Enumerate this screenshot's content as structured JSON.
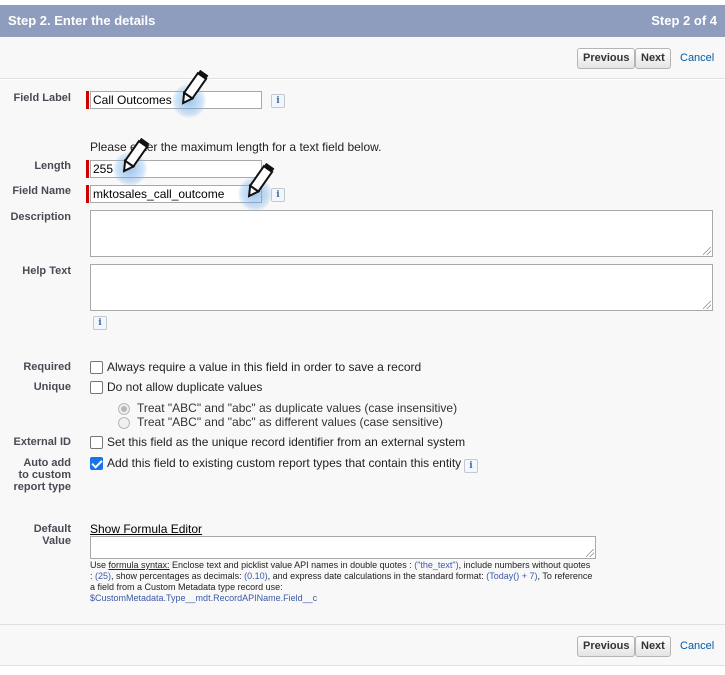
{
  "header": {
    "title": "Step 2. Enter the details",
    "step": "Step 2 of 4"
  },
  "toolbar": {
    "previous": "Previous",
    "next": "Next",
    "cancel": "Cancel"
  },
  "form": {
    "field_label": {
      "label": "Field Label",
      "value": "Call Outcomes"
    },
    "length_hint": "Please enter the maximum length for a text field below.",
    "length": {
      "label": "Length",
      "value": "255"
    },
    "field_name": {
      "label": "Field Name",
      "value": "mktosales_call_outcome"
    },
    "description": {
      "label": "Description",
      "value": ""
    },
    "help_text": {
      "label": "Help Text",
      "value": ""
    },
    "required": {
      "label": "Required",
      "text": "Always require a value in this field in order to save a record",
      "checked": false
    },
    "unique": {
      "label": "Unique",
      "text": "Do not allow duplicate values",
      "checked": false,
      "option_insensitive": "Treat \"ABC\" and \"abc\" as duplicate values (case insensitive)",
      "option_sensitive": "Treat \"ABC\" and \"abc\" as different values (case sensitive)"
    },
    "external_id": {
      "label": "External ID",
      "text": "Set this field as the unique record identifier from an external system",
      "checked": false
    },
    "auto_add": {
      "label_1": "Auto add",
      "label_2": "to custom",
      "label_3": "report type",
      "text": "Add this field to existing custom report types that contain this entity",
      "checked": true
    },
    "default_value": {
      "label_1": "Default",
      "label_2": "Value",
      "link": "Show Formula Editor",
      "value": ""
    },
    "help": {
      "use": "Use ",
      "syntax": "formula syntax:",
      "p1": " Enclose text and picklist value API names in double quotes : ",
      "ex1": "(\"the_text\")",
      "p2": ", include numbers without quotes : ",
      "ex2": "(25)",
      "p3": ", show percentages as decimals: ",
      "ex3": "(0.10)",
      "p4": ", and express date calculations in the standard format: ",
      "ex4": "(Today() + 7)",
      "p5": ", To reference a field from a Custom Metadata type record use:",
      "ex5": "$CustomMetadata.Type__mdt.RecordAPIName.Field__c"
    }
  },
  "info_icon": "i",
  "colors": {
    "header_bg": "#8e9dbe",
    "required": "#cc0000",
    "link": "#015ba7"
  }
}
